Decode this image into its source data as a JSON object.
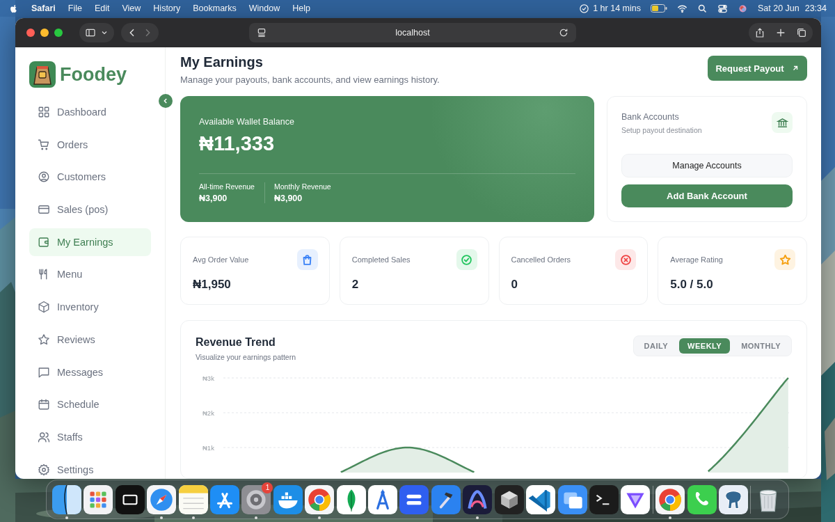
{
  "menu_bar": {
    "app": "Safari",
    "menus": [
      "File",
      "Edit",
      "View",
      "History",
      "Bookmarks",
      "Window",
      "Help"
    ],
    "battery_time": "1 hr 14 mins",
    "date": "Sat 20 Jun",
    "time": "23:34"
  },
  "browser": {
    "address": "localhost"
  },
  "sidebar": {
    "brand": "Foodey",
    "items": [
      {
        "label": "Dashboard",
        "kind": "grid",
        "selected": false
      },
      {
        "label": "Orders",
        "kind": "cart",
        "selected": false
      },
      {
        "label": "Customers",
        "kind": "user",
        "selected": false
      },
      {
        "label": "Sales (pos)",
        "kind": "card",
        "selected": false
      },
      {
        "label": "My Earnings",
        "kind": "wallet",
        "selected": true
      },
      {
        "label": "Menu",
        "kind": "fork",
        "selected": false
      },
      {
        "label": "Inventory",
        "kind": "box",
        "selected": false
      },
      {
        "label": "Reviews",
        "kind": "star",
        "selected": false
      },
      {
        "label": "Messages",
        "kind": "chat",
        "selected": false
      },
      {
        "label": "Schedule",
        "kind": "calendar",
        "selected": false
      },
      {
        "label": "Staffs",
        "kind": "users",
        "selected": false
      },
      {
        "label": "Settings",
        "kind": "gear",
        "selected": false
      }
    ]
  },
  "header": {
    "title": "My Earnings",
    "subtitle": "Manage your payouts, bank accounts, and view earnings history.",
    "action": "Request Payout"
  },
  "wallet": {
    "label": "Available Wallet Balance",
    "balance": "₦11,333",
    "stats": [
      {
        "label": "All-time Revenue",
        "value": "₦3,900"
      },
      {
        "label": "Monthly Revenue",
        "value": "₦3,900"
      }
    ]
  },
  "bank_accounts": {
    "title": "Bank Accounts",
    "subtitle": "Setup payout destination",
    "buttons": [
      {
        "label": "Manage Accounts",
        "kind": "secondary"
      },
      {
        "label": "Add Bank Account",
        "kind": "primary"
      }
    ]
  },
  "stats": [
    {
      "label": "Avg Order Value",
      "value": "₦1,950",
      "kind": "bag",
      "color": "#3b82f6"
    },
    {
      "label": "Completed Sales",
      "value": "2",
      "kind": "check",
      "color": "#22c55e"
    },
    {
      "label": "Cancelled Orders",
      "value": "0",
      "kind": "cancel",
      "color": "#ef4444"
    },
    {
      "label": "Average Rating",
      "value": "5.0 / 5.0",
      "kind": "star",
      "color": "#f59e0b"
    }
  ],
  "revenue_trend": {
    "title": "Revenue Trend",
    "subtitle": "Visualize your earnings pattern",
    "tabs": [
      {
        "label": "DAILY",
        "selected": false
      },
      {
        "label": "WEEKLY",
        "selected": true
      },
      {
        "label": "MONTHLY",
        "selected": false
      }
    ],
    "y_axis_labels": [
      "₦3k",
      "₦2k",
      "₦1k"
    ]
  },
  "dock": {
    "items": [
      {
        "kind": "finder",
        "running": true
      },
      {
        "kind": "launchpad",
        "running": false
      },
      {
        "kind": "tv",
        "running": false
      },
      {
        "kind": "compass",
        "running": true
      },
      {
        "kind": "notes",
        "running": true
      },
      {
        "kind": "store",
        "running": false
      },
      {
        "kind": "settings",
        "running": true,
        "badge": "1"
      },
      {
        "kind": "whale",
        "running": false
      },
      {
        "kind": "chrome",
        "running": true
      },
      {
        "kind": "leaf",
        "running": false
      },
      {
        "kind": "drafting",
        "running": false
      },
      {
        "kind": "bars",
        "running": false
      },
      {
        "kind": "hammer",
        "running": false
      },
      {
        "kind": "arch",
        "running": true
      },
      {
        "kind": "cube",
        "running": false
      },
      {
        "kind": "ribbon",
        "running": false
      },
      {
        "kind": "windows",
        "running": false
      },
      {
        "kind": "terminal",
        "running": false
      },
      {
        "kind": "triangle",
        "running": false
      },
      {
        "kind": "separator"
      },
      {
        "kind": "chrome",
        "running": true
      },
      {
        "kind": "phone",
        "running": false
      },
      {
        "kind": "elephant",
        "running": false
      },
      {
        "kind": "separator"
      },
      {
        "kind": "trash",
        "running": false
      }
    ]
  }
}
